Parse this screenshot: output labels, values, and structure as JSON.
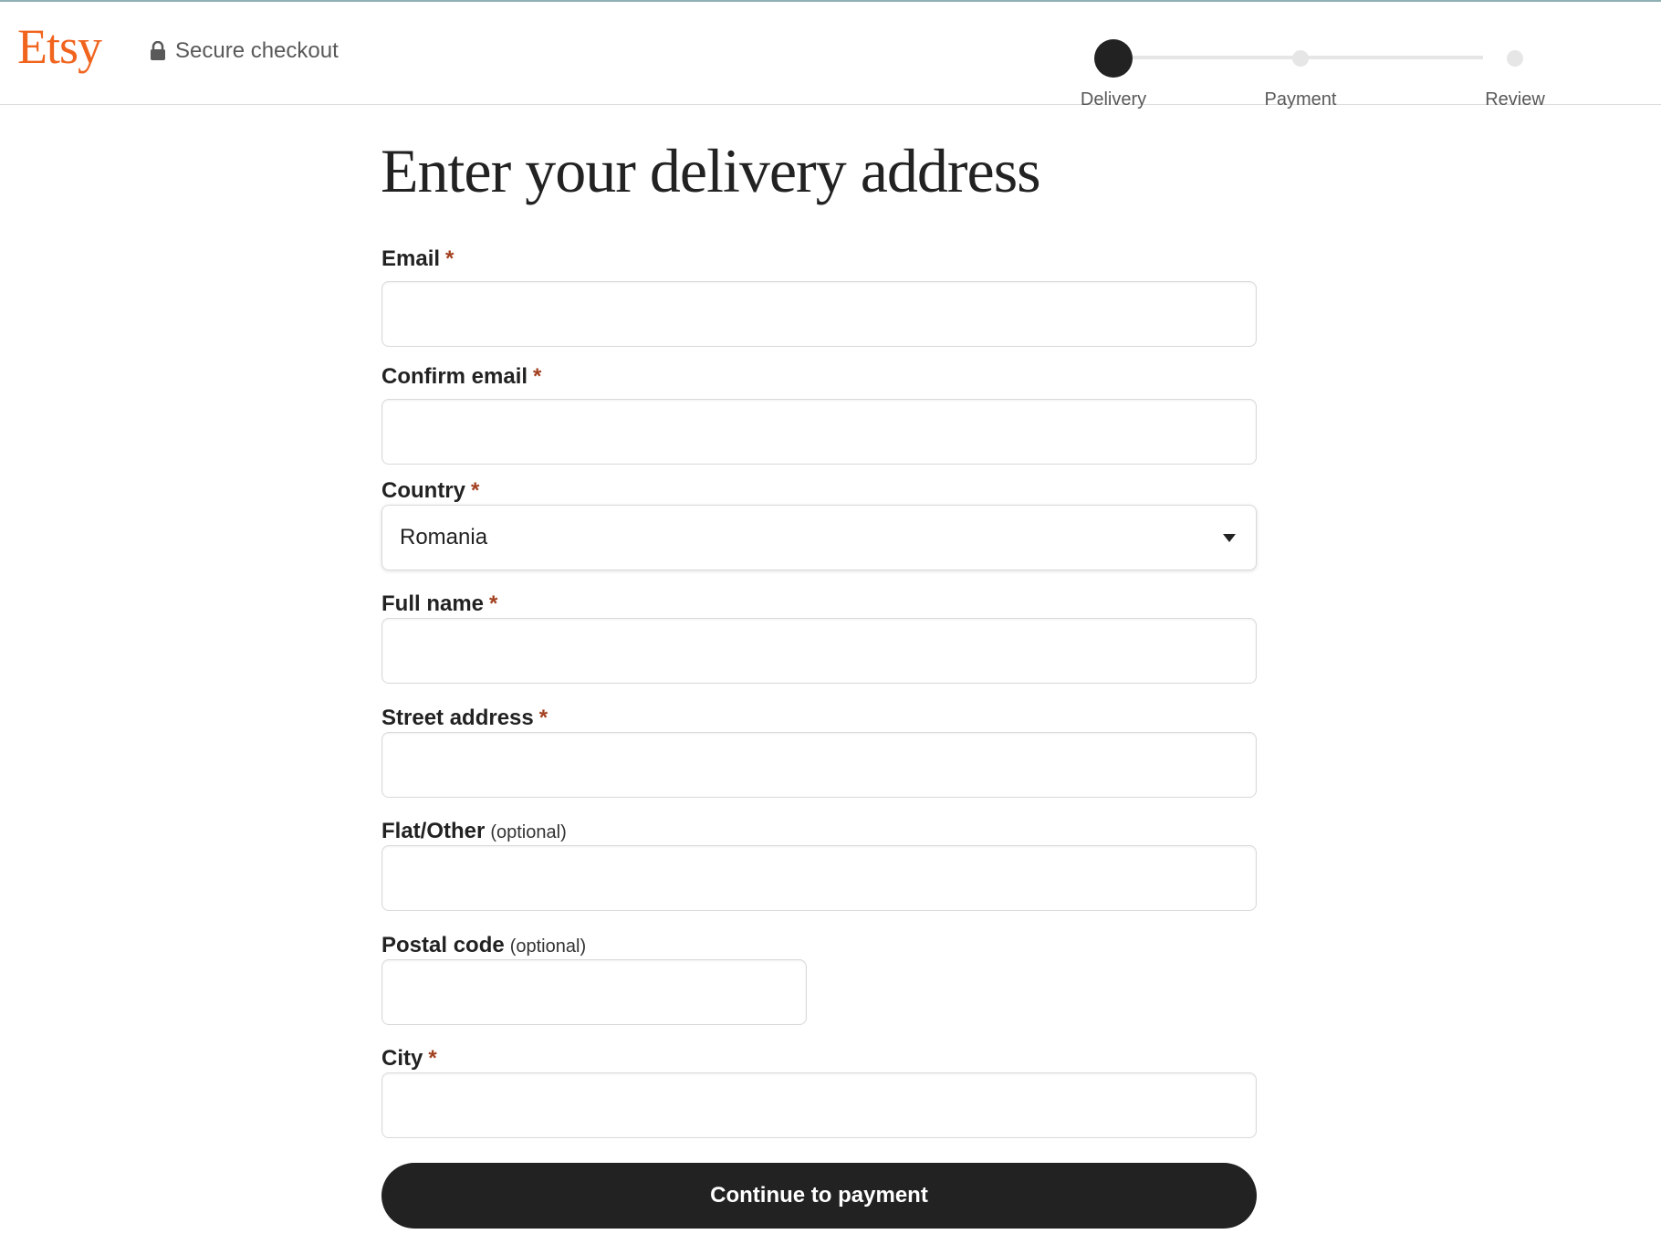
{
  "header": {
    "logo": "Etsy",
    "secure_label": "Secure checkout",
    "brand_color": "#f1641e"
  },
  "stepper": {
    "steps": [
      {
        "label": "Delivery",
        "state": "active"
      },
      {
        "label": "Payment",
        "state": "upcoming"
      },
      {
        "label": "Review",
        "state": "upcoming"
      }
    ]
  },
  "form": {
    "title": "Enter your delivery address",
    "required_marker": "*",
    "optional_marker": "(optional)",
    "fields": {
      "email": {
        "label": "Email",
        "value": "",
        "required": true
      },
      "confirm_email": {
        "label": "Confirm email",
        "value": "",
        "required": true
      },
      "country": {
        "label": "Country",
        "value": "Romania",
        "required": true
      },
      "full_name": {
        "label": "Full name",
        "value": "",
        "required": true
      },
      "street": {
        "label": "Street address",
        "value": "",
        "required": true
      },
      "flat": {
        "label": "Flat/Other",
        "value": "",
        "required": false
      },
      "postal": {
        "label": "Postal code",
        "value": "",
        "required": false
      },
      "city": {
        "label": "City",
        "value": "",
        "required": true
      }
    },
    "submit_label": "Continue to payment"
  }
}
